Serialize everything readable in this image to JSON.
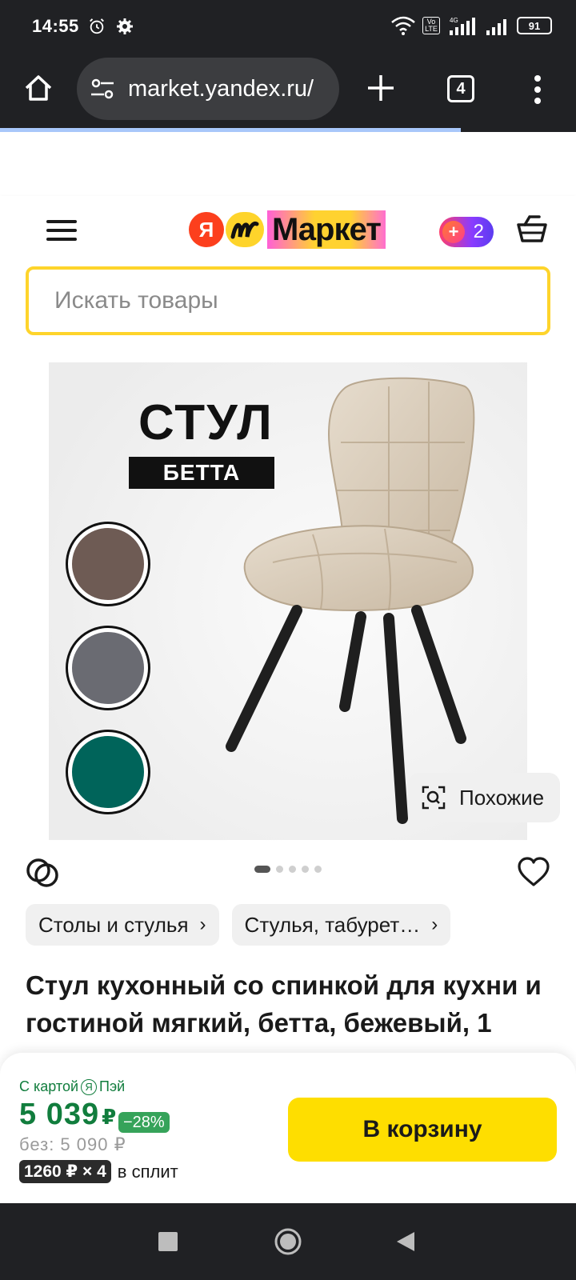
{
  "status_bar": {
    "time": "14:55",
    "network": "4G",
    "volte": "Vo LTE",
    "battery": "91"
  },
  "browser": {
    "url": "market.yandex.ru/",
    "tab_count": "4",
    "load_progress": 0.8
  },
  "header": {
    "logo_ya": "Я",
    "logo_text": "Маркет",
    "plus_points": "2",
    "search_placeholder": "Искать товары"
  },
  "gallery": {
    "title": "СТУЛ",
    "tag": "БЕТТА",
    "swatches": [
      "#6e5b54",
      "#6a6b72",
      "#00645a"
    ],
    "similar_label": "Похожие",
    "image_count": 5,
    "active_image": 1
  },
  "breadcrumbs": [
    {
      "label": "Столы и стулья"
    },
    {
      "label": "Стулья, табурет…"
    }
  ],
  "product": {
    "title": "Стул кухонный со спинкой для кухни и гостиной мягкий, бетта, бежевый, 1"
  },
  "buy": {
    "card_prefix": "С картой",
    "card_ya": "Я",
    "card_suffix": "Пэй",
    "price": "5 039",
    "currency": "₽",
    "discount": "−28%",
    "old_price": "без: 5 090 ₽",
    "split_badge": "1260 ₽ × 4",
    "split_text": "в сплит",
    "cart_button": "В корзину"
  },
  "colors": {
    "accent_yellow": "#fede00",
    "price_green": "#117d3d",
    "discount_green": "#36a35a",
    "chrome_dark": "#202124"
  }
}
